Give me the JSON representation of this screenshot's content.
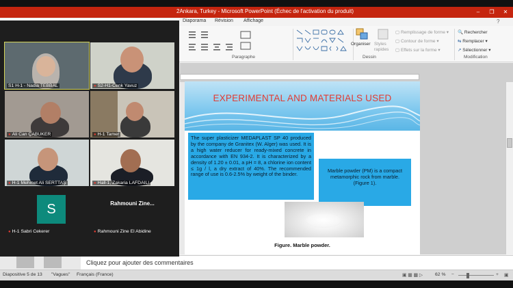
{
  "window": {
    "title": "2Ankara, Turkey - Microsoft PowerPoint (Échec de l'activation du produit)"
  },
  "ribbon": {
    "tabs": [
      "Diaporama",
      "Révision",
      "Affichage"
    ],
    "groups": {
      "paragraphe": "Paragraphe",
      "dessin": "Dessin",
      "modification": "Modification"
    },
    "drawing": {
      "organiser": "Organiser",
      "styles_rapides": "Styles rapides",
      "remplissage": "Remplissage de forme",
      "contour": "Contour de forme",
      "effets": "Effets sur la forme"
    },
    "editing": {
      "rechercher": "Rechercher",
      "remplacer": "Remplacer",
      "selectionner": "Sélectionner"
    }
  },
  "slide": {
    "title": "EXPERIMENTAL AND MATERIALS USED",
    "left_text": "The super plasticizer MEDAPLAST SP 40 produced by the company de Granitex (W. Alger) was used. It is a high water reducer for ready-mixed concrete in accordance with EN 934-2. It is characterized by a density of 1.20 ± 0.01, a pH = 8, a chlorine ion content ≤ 1g / l, a dry extract of 40%. The recommended range of use is 0.6-2.5% by weight of the binder.",
    "right_text": "Marble powder (PM) is a compact metamorphic rock from marble. (Figure 1).",
    "caption": "Figure. Marble powder."
  },
  "notes": {
    "placeholder": "Cliquez pour ajouter des commentaires"
  },
  "status": {
    "slide_of": "Diapositive 5 de 13",
    "theme": "\"Vagues\"",
    "language": "Français (France)",
    "zoom": "62 %"
  },
  "participants": [
    {
      "name": "S1 H-1 - Nadia TEBBAL",
      "muted": false,
      "active": true
    },
    {
      "name": "S2-H1-Cenk Yavuz",
      "muted": true,
      "active": false
    },
    {
      "name": "Ali Can ÇABUKER",
      "muted": true,
      "active": false
    },
    {
      "name": "H-1 Tamer",
      "muted": true,
      "active": false
    },
    {
      "name": "H-1 Mehmet Ali SERTTAŞ",
      "muted": true,
      "active": false
    },
    {
      "name": "Hall-1, Zakaria LAFDAILI",
      "muted": true,
      "active": false
    },
    {
      "name": "H-1 Sabri Cekerer",
      "muted": true,
      "active": false,
      "initial": "S"
    },
    {
      "name": "Rahmouni Zine El Abidine",
      "muted": true,
      "active": false,
      "display": "Rahmouni Zine..."
    }
  ]
}
